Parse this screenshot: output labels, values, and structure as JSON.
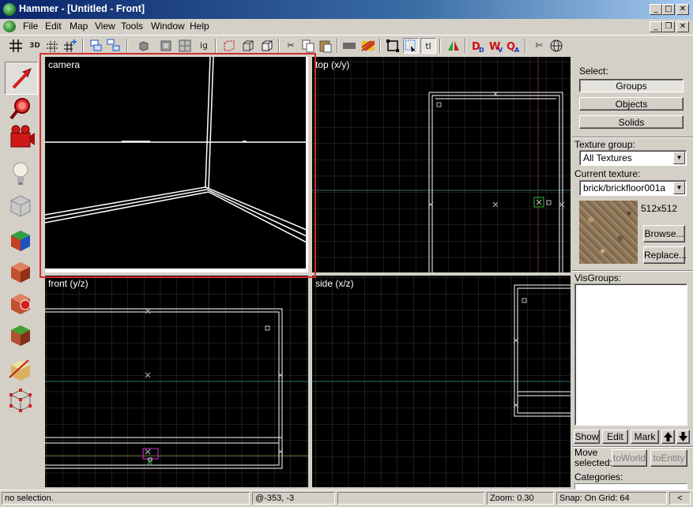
{
  "window": {
    "title": "Hammer - [Untitled - Front]"
  },
  "menu": {
    "items": [
      "File",
      "Edit",
      "Map",
      "View",
      "Tools",
      "Window",
      "Help"
    ]
  },
  "toolbar": {
    "texts": {
      "grid_3d": "3D",
      "ignore_groups": "ig",
      "texture_lock": "tl"
    }
  },
  "tools": [
    "selection-tool",
    "magnify-tool",
    "camera-tool",
    "entity-tool",
    "block-tool",
    "toggle-texture-tool",
    "apply-decal-tool",
    "apply-overlay-tool",
    "clipping-tool",
    "vertex-tool"
  ],
  "viewports": {
    "camera": {
      "label": "camera"
    },
    "top": {
      "label": "top (x/y)"
    },
    "front": {
      "label": "front (y/z)"
    },
    "side": {
      "label": "side (x/z)"
    }
  },
  "panel": {
    "select_label": "Select:",
    "select_buttons": {
      "groups": "Groups",
      "objects": "Objects",
      "solids": "Solids"
    },
    "texture_group_label": "Texture group:",
    "texture_group_value": "All Textures",
    "current_texture_label": "Current texture:",
    "current_texture_value": "brick/brickfloor001a",
    "texture_size": "512x512",
    "browse": "Browse...",
    "replace": "Replace...",
    "visgroups_label": "VisGroups:",
    "show": "Show",
    "edit": "Edit",
    "mark": "Mark",
    "move_selected": "Move\nselected:",
    "move_selected_line1": "Move",
    "move_selected_line2": "selected:",
    "to_world": "toWorld",
    "to_entity": "toEntity",
    "categories_label": "Categories:"
  },
  "status": {
    "selection": "no selection.",
    "coords": "@-353, -3",
    "zoom": "Zoom: 0.30",
    "snap": "Snap: On Grid: 64"
  },
  "colors": {
    "grid": "#3a3a3a",
    "axis": "#2e6e6e",
    "highlight": "#d03030",
    "title_bar": "#0a246a"
  }
}
